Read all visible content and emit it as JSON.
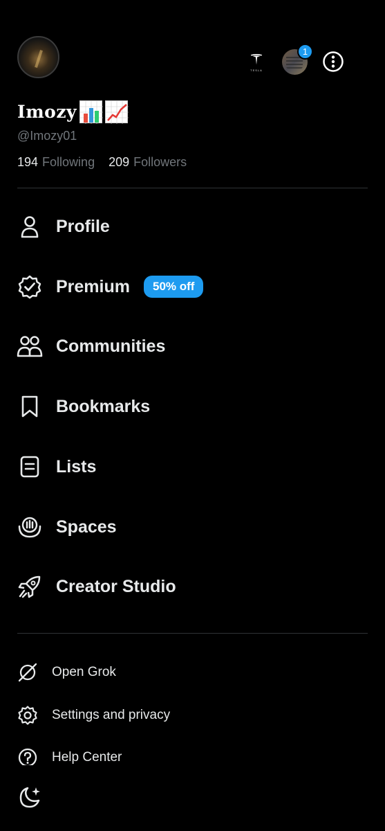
{
  "profile": {
    "display_name": "Imozy",
    "handle": "@Imozy01",
    "following_count": "194",
    "following_label": "Following",
    "followers_count": "209",
    "followers_label": "Followers",
    "emojis": [
      "bar-chart-emoji",
      "chart-increasing-emoji"
    ]
  },
  "header": {
    "tesla_label": "TESLA",
    "notification_badge": "1"
  },
  "menu": {
    "profile": "Profile",
    "premium": "Premium",
    "premium_badge": "50% off",
    "communities": "Communities",
    "bookmarks": "Bookmarks",
    "lists": "Lists",
    "spaces": "Spaces",
    "creator_studio": "Creator Studio"
  },
  "secondary": {
    "open_grok": "Open Grok",
    "settings": "Settings and privacy",
    "help": "Help Center"
  },
  "colors": {
    "accent": "#1d9bf0",
    "background": "#000000",
    "muted": "#71767b",
    "text": "#e7e9ea"
  }
}
